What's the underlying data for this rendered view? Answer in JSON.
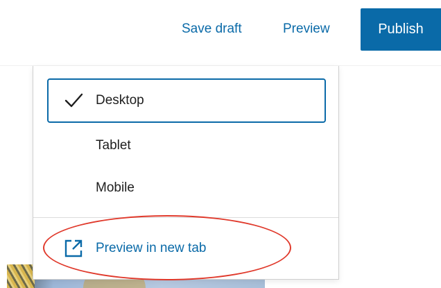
{
  "toolbar": {
    "save_draft_label": "Save draft",
    "preview_label": "Preview",
    "publish_label": "Publish"
  },
  "preview_menu": {
    "items": [
      {
        "label": "Desktop",
        "selected": true,
        "icon": "check-icon"
      },
      {
        "label": "Tablet",
        "selected": false
      },
      {
        "label": "Mobile",
        "selected": false
      }
    ],
    "new_tab": {
      "label": "Preview in new tab",
      "icon": "external-link-icon"
    }
  },
  "colors": {
    "accent": "#0a6aa8",
    "highlight": "#e0392b",
    "text": "#1e1e1e"
  }
}
